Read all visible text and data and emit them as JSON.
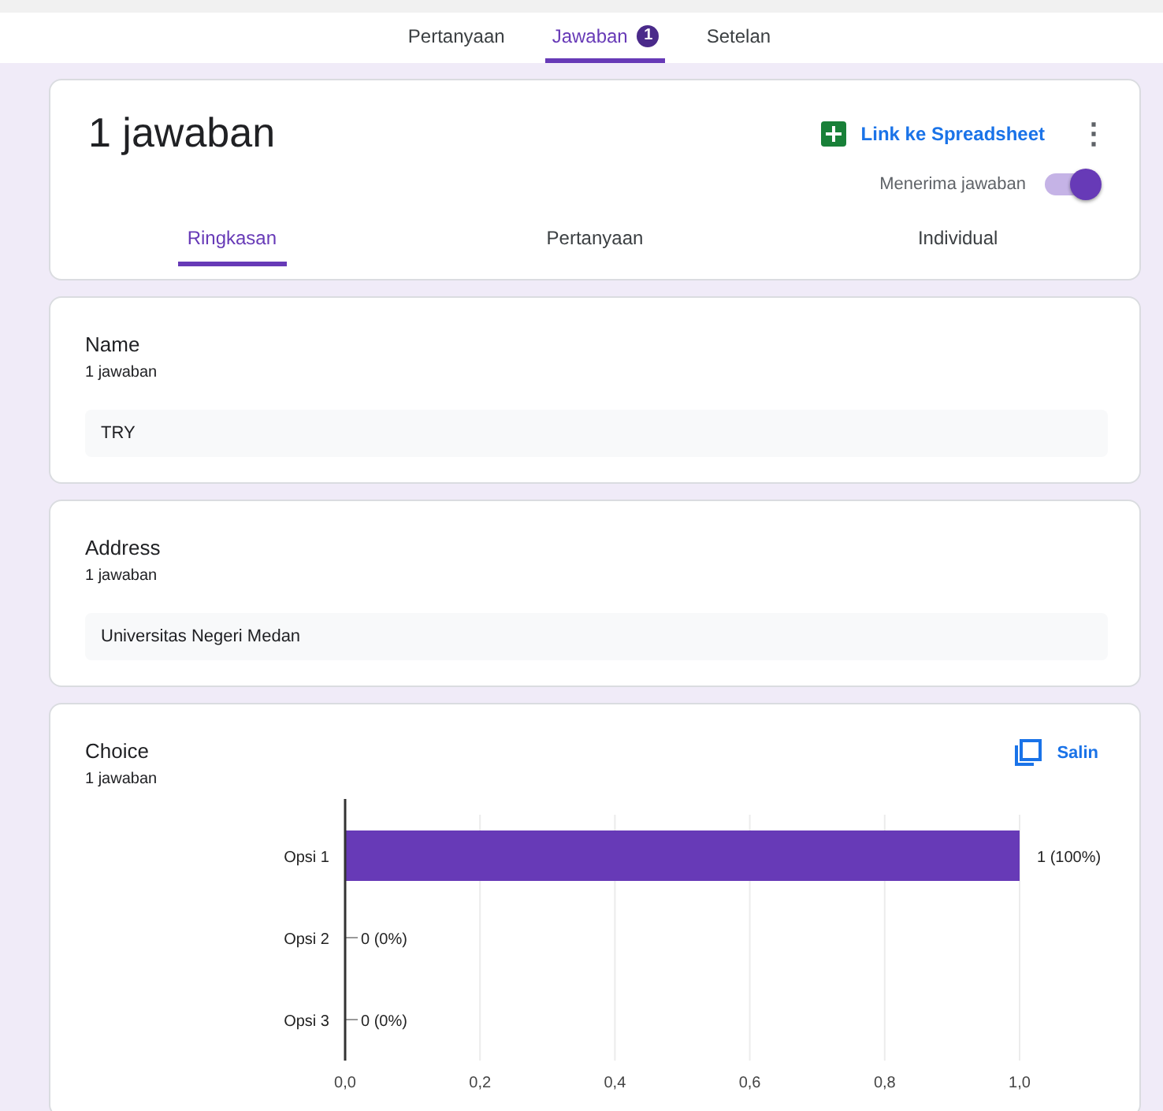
{
  "top_tabs": [
    {
      "label": "Pertanyaan",
      "selected": false
    },
    {
      "label": "Jawaban",
      "selected": true,
      "badge": "1"
    },
    {
      "label": "Setelan",
      "selected": false
    }
  ],
  "summary": {
    "title": "1 jawaban",
    "spreadsheet_link": "Link ke Spreadsheet",
    "more": "⋮",
    "accepting": {
      "label": "Menerima jawaban",
      "on": true
    },
    "tabs": [
      {
        "label": "Ringkasan",
        "selected": true
      },
      {
        "label": "Pertanyaan",
        "selected": false
      },
      {
        "label": "Individual",
        "selected": false
      }
    ]
  },
  "questions": [
    {
      "kind": "text",
      "title": "Name",
      "count": "1 jawaban",
      "answers": [
        "TRY"
      ]
    },
    {
      "kind": "text",
      "title": "Address",
      "count": "1 jawaban",
      "answers": [
        "Universitas Negeri Medan"
      ]
    },
    {
      "kind": "chart",
      "title": "Choice",
      "count": "1 jawaban",
      "copy": "Salin",
      "chart_data": {
        "type": "bar",
        "orientation": "horizontal",
        "categories": [
          "Opsi 1",
          "Opsi 2",
          "Opsi 3"
        ],
        "series": [
          {
            "color": "#673ab7",
            "values": [
              1,
              0,
              0
            ]
          }
        ],
        "grid": true,
        "value_labels": [
          "1 (100%)",
          "0 (0%)",
          "0 (0%)"
        ],
        "xlim": [
          0,
          1
        ],
        "xticks": [
          {
            "value": 0,
            "label": "0,0"
          },
          {
            "value": 0.2,
            "label": "0,2"
          },
          {
            "value": 0.4,
            "label": "0,4"
          },
          {
            "value": 0.6,
            "label": "0,6"
          },
          {
            "value": 0.8,
            "label": "0,8"
          },
          {
            "value": 1,
            "label": "1,0"
          }
        ]
      }
    }
  ]
}
